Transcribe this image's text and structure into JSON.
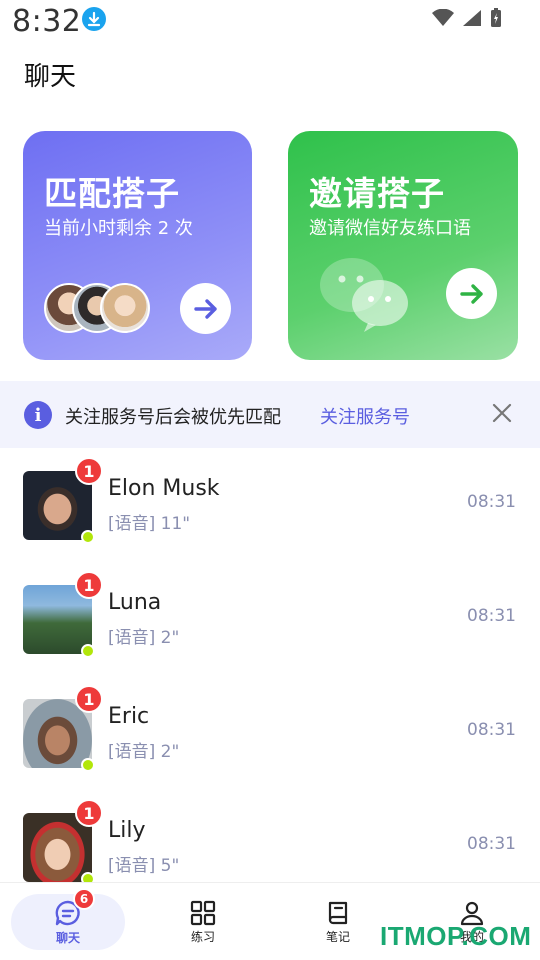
{
  "status_bar": {
    "time": "8:32"
  },
  "header": {
    "title": "聊天"
  },
  "cards": {
    "match": {
      "title": "匹配搭子",
      "subtitle": "当前小时剩余 2 次"
    },
    "invite": {
      "title": "邀请搭子",
      "subtitle": "邀请微信好友练口语"
    }
  },
  "notice": {
    "text": "关注服务号后会被优先匹配",
    "link": "关注服务号"
  },
  "chats": [
    {
      "name": "Elon Musk",
      "preview": "[语音] 11\"",
      "time": "08:31",
      "unread": "1"
    },
    {
      "name": "Luna",
      "preview": "[语音] 2\"",
      "time": "08:31",
      "unread": "1"
    },
    {
      "name": "Eric",
      "preview": "[语音] 2\"",
      "time": "08:31",
      "unread": "1"
    },
    {
      "name": "Lily",
      "preview": "[语音] 5\"",
      "time": "08:31",
      "unread": "1"
    }
  ],
  "tabs": [
    {
      "label": "聊天",
      "badge": "6",
      "icon": "chat-bubble-icon",
      "active": true
    },
    {
      "label": "练习",
      "icon": "grid-icon"
    },
    {
      "label": "笔记",
      "icon": "notebook-icon"
    },
    {
      "label": "我的",
      "icon": "person-icon"
    }
  ],
  "watermark": "ITMOP.COM",
  "colors": {
    "accent": "#5a5ee0",
    "green": "#2fc14b",
    "badge_red": "#ee3a3a",
    "online": "#b2e60a"
  }
}
